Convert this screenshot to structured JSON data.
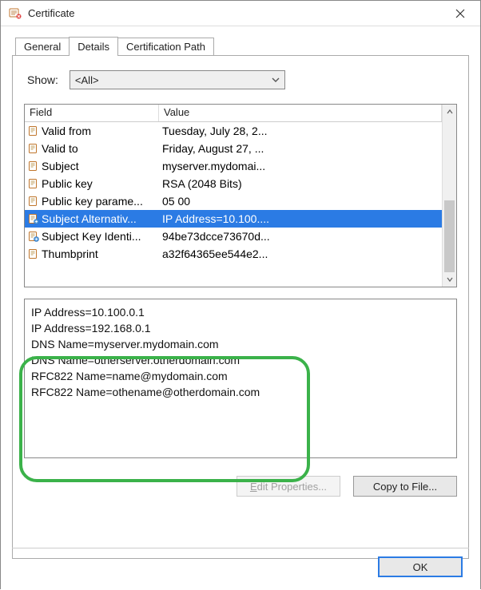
{
  "window": {
    "title": "Certificate"
  },
  "tabs": {
    "general": "General",
    "details": "Details",
    "certpath": "Certification Path",
    "active": "details"
  },
  "show": {
    "label": "Show:",
    "value": "<All>"
  },
  "listview": {
    "header_field": "Field",
    "header_value": "Value",
    "rows": [
      {
        "icon": "prop",
        "field": "Valid from",
        "value": "Tuesday, July 28, 2..."
      },
      {
        "icon": "prop",
        "field": "Valid to",
        "value": "Friday, August 27, ..."
      },
      {
        "icon": "prop",
        "field": "Subject",
        "value": "myserver.mydomai..."
      },
      {
        "icon": "prop",
        "field": "Public key",
        "value": "RSA (2048 Bits)"
      },
      {
        "icon": "prop",
        "field": "Public key parame...",
        "value": "05 00"
      },
      {
        "icon": "ext",
        "field": "Subject Alternativ...",
        "value": "IP Address=10.100....",
        "selected": true
      },
      {
        "icon": "ext",
        "field": "Subject Key Identi...",
        "value": "94be73dcce73670d..."
      },
      {
        "icon": "prop",
        "field": "Thumbprint",
        "value": "a32f64365ee544e2..."
      }
    ]
  },
  "detail_text": "IP Address=10.100.0.1\nIP Address=192.168.0.1\nDNS Name=myserver.mydomain.com\nDNS Name=otherserver.otherdomain.com\nRFC822 Name=name@mydomain.com\nRFC822 Name=othename@otherdomain.com",
  "buttons": {
    "edit_props": "Edit Properties...",
    "copy_to_file": "Copy to File...",
    "ok": "OK"
  }
}
